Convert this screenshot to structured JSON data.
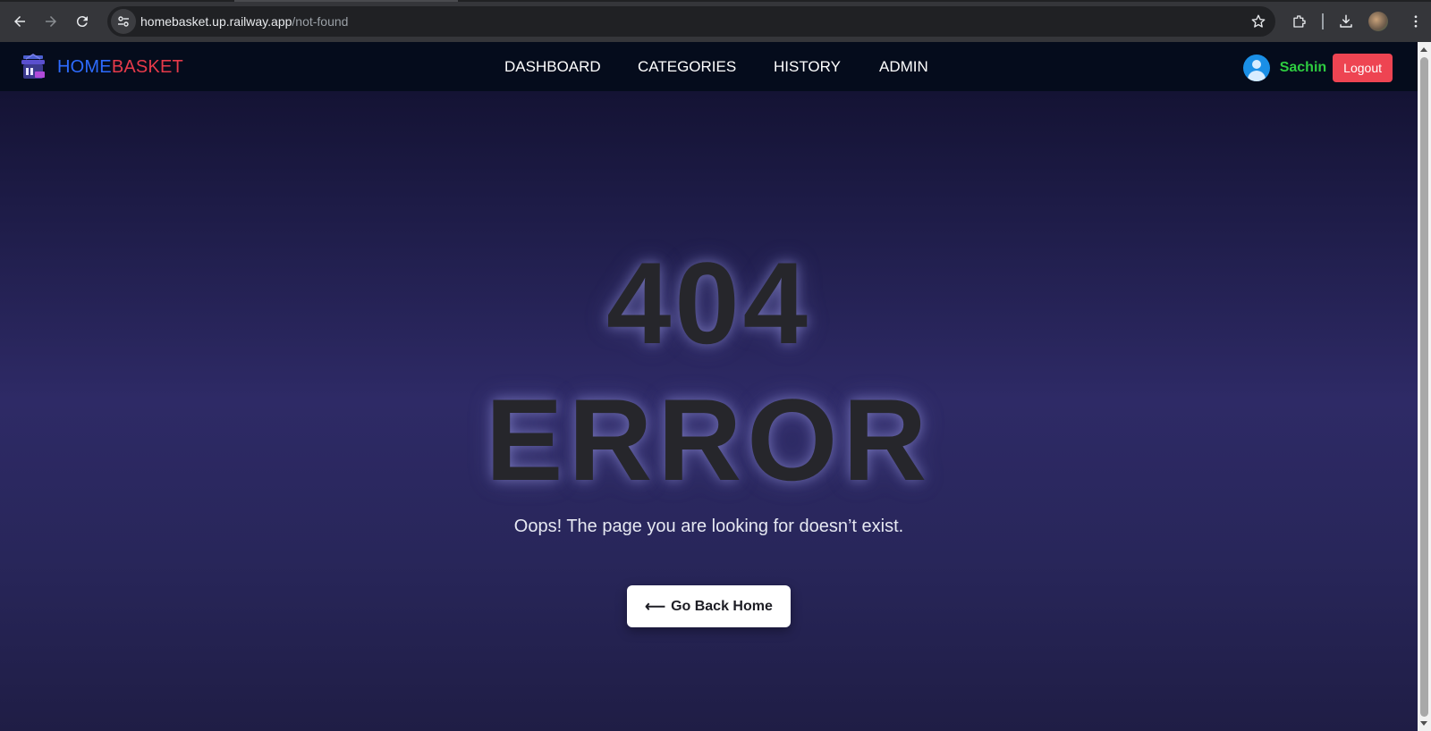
{
  "browser": {
    "url_host": "homebasket.up.railway.app",
    "url_path": "/not-found",
    "icons": [
      "back-icon",
      "forward-icon",
      "reload-icon",
      "site-info-icon",
      "bookmark-star-icon",
      "extensions-icon",
      "download-icon",
      "profile-avatar",
      "more-menu-icon"
    ]
  },
  "navbar": {
    "brand_home": "HOME",
    "brand_basket": "BASKET",
    "links": [
      "DASHBOARD",
      "CATEGORIES",
      "HISTORY",
      "ADMIN"
    ],
    "username": "Sachin",
    "logout_label": "Logout"
  },
  "error": {
    "code": "404",
    "word": "ERROR",
    "message": "Oops! The page you are looking for doesn’t exist.",
    "button_arrow": "⟵",
    "button_label": "Go Back Home"
  },
  "colors": {
    "brand_home": "#2d6bff",
    "brand_basket": "#e63a4a",
    "username": "#2ecc40",
    "logout": "#ee4452",
    "navbar_bg": "#050c1c"
  }
}
